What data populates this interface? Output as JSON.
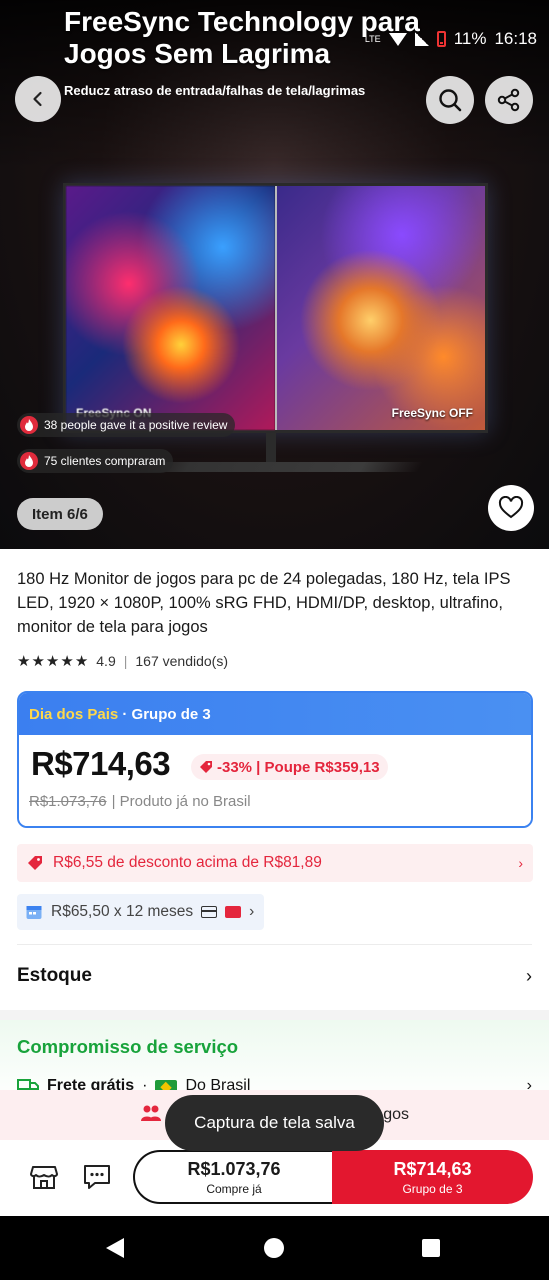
{
  "status_bar": {
    "battery": "11%",
    "time": "16:18",
    "network": "LTE"
  },
  "hero": {
    "title": "FreeSync Technology para Jogos Sem Lagrima",
    "subtitle": "Reducz atraso de entrada/falhas de tela/lagrimas",
    "left_label": "FreeSync ON",
    "right_label": "FreeSync OFF",
    "social": [
      "38 people gave it a positive review",
      "75 clientes compraram"
    ],
    "item_counter": "Item 6/6"
  },
  "product": {
    "title": "180 Hz Monitor de jogos para pc de 24 polegadas, 180 Hz, tela IPS LED, 1920 × 1080P, 100% sRG FHD, HDMI/DP, desktop, ultrafino, monitor de tela para jogos",
    "rating": "4.9",
    "sold": "167 vendido(s)",
    "stars": 5
  },
  "deal": {
    "promo": "Dia dos Pais",
    "group": "· Grupo de 3",
    "price": "R$714,63",
    "discount": "-33% | Poupe R$359,13",
    "old_price": "R$1.073,76",
    "origin": "| Produto já no Brasil"
  },
  "coupon": "R$6,55 de desconto acima de R$81,89",
  "installment": "R$65,50 x 12 meses",
  "stock": "Estoque",
  "service": {
    "title": "Compromisso de serviço",
    "frete": "Frete grátis",
    "origin": "Do Brasil"
  },
  "group_bar": {
    "text_end": "gos"
  },
  "toast": "Captura de tela salva",
  "actions": {
    "alone_price": "R$1.073,76",
    "alone_label": "Compre já",
    "group_price": "R$714,63",
    "group_label": "Grupo de 3"
  },
  "colors": {
    "accent_red": "#e3172f",
    "deal_blue": "#3b82f0",
    "service_green": "#18a33b"
  }
}
